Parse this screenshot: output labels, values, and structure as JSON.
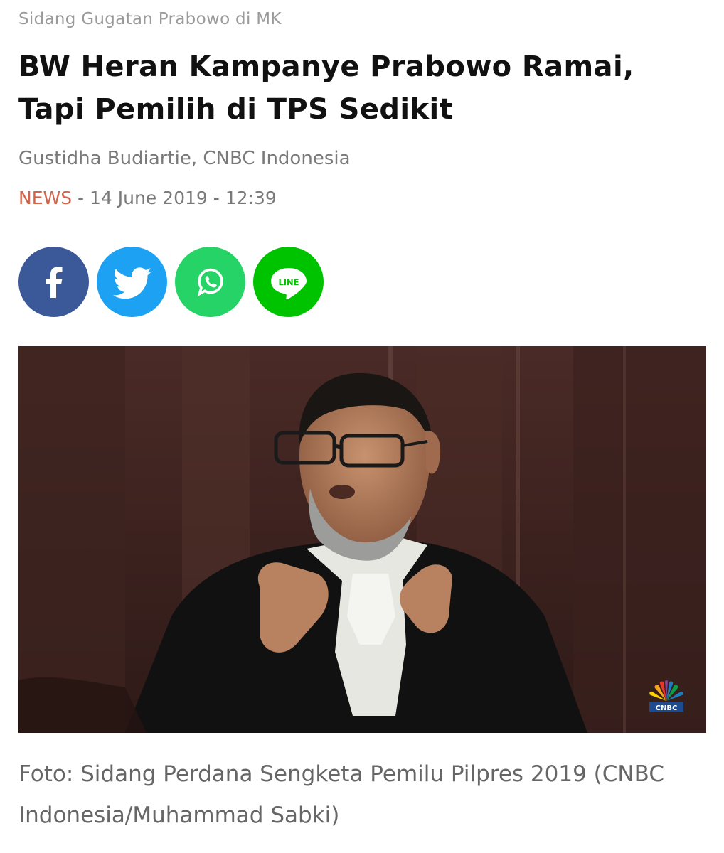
{
  "article": {
    "kicker": "Sidang Gugatan Prabowo di MK",
    "headline": "BW Heran Kampanye Prabowo Ramai, Tapi Pemilih di TPS Sedikit",
    "author": "Gustidha Budiartie, CNBC Indonesia",
    "category": "NEWS",
    "separator": "-",
    "date": "14 June 2019",
    "time": "12:39"
  },
  "share": {
    "buttons": [
      {
        "network": "facebook",
        "icon": "facebook-icon",
        "color": "#3b5998"
      },
      {
        "network": "twitter",
        "icon": "twitter-bird-icon",
        "color": "#1da1f2"
      },
      {
        "network": "whatsapp",
        "icon": "whatsapp-icon",
        "color": "#25d366"
      },
      {
        "network": "line",
        "icon": "line-icon",
        "color": "#00c300",
        "label": "LINE"
      }
    ]
  },
  "photo": {
    "watermark_text": "CNBC",
    "caption": "Foto: Sidang Perdana Sengketa Pemilu Pilpres 2019 (CNBC Indonesia/Muhammad Sabki)"
  },
  "colors": {
    "kicker": "#9a9a9a",
    "headline": "#111111",
    "meta": "#7a7a7a",
    "category": "#d4634a",
    "caption": "#666666"
  }
}
